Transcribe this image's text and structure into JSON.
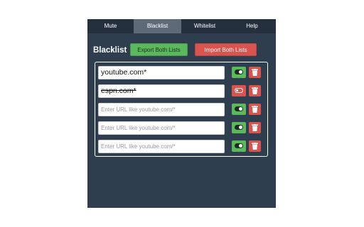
{
  "tabs": [
    {
      "label": "Mute",
      "active": false
    },
    {
      "label": "Blacklist",
      "active": true
    },
    {
      "label": "Whitelist",
      "active": false
    },
    {
      "label": "Help",
      "active": false
    }
  ],
  "header": {
    "title": "Blacklist",
    "export_label": "Export Both Lists",
    "import_label": "Import Both Lists"
  },
  "entries": [
    {
      "value": "youtube.com*",
      "placeholder": "",
      "enabled": true,
      "toggle_icon": "toggle-on-icon",
      "delete_icon": "trash-icon"
    },
    {
      "value": "espn.com*",
      "placeholder": "",
      "enabled": false,
      "toggle_icon": "toggle-off-icon",
      "delete_icon": "trash-icon"
    },
    {
      "value": "",
      "placeholder": "Enter URL like youtube.com/*",
      "enabled": true,
      "toggle_icon": "toggle-on-icon",
      "delete_icon": "trash-icon"
    },
    {
      "value": "",
      "placeholder": "Enter URL like youtube.com/*",
      "enabled": true,
      "toggle_icon": "toggle-on-icon",
      "delete_icon": "trash-icon"
    },
    {
      "value": "",
      "placeholder": "Enter URL like youtube.com/*",
      "enabled": true,
      "toggle_icon": "toggle-on-icon",
      "delete_icon": "trash-icon"
    }
  ],
  "colors": {
    "panel_bg": "#2f3e4f",
    "tab_bar_bg": "#24303d",
    "active_tab_bg": "#5d6b78",
    "success": "#5cb85c",
    "danger": "#d9534f"
  }
}
